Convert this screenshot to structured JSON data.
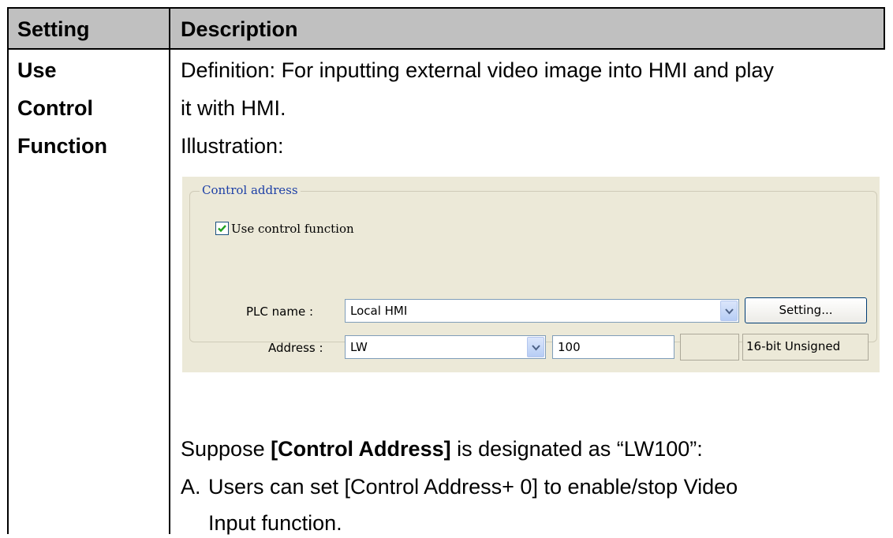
{
  "table": {
    "header": {
      "setting": "Setting",
      "description": "Description"
    },
    "row": {
      "setting_lines": [
        "Use",
        "Control",
        "Function"
      ],
      "definition_line1": "Definition: For inputting external video image into HMI and play",
      "definition_line2": "it with HMI.",
      "illustration_label": "Illustration:",
      "suppose_prefix": "Suppose ",
      "suppose_bold": "[Control Address]",
      "suppose_suffix": " is designated as “LW100”:",
      "item_a_marker": "A.",
      "item_a_line1": "Users can set [Control Address+ 0] to enable/stop Video",
      "item_a_line2": "Input function."
    }
  },
  "illustration": {
    "group_title": "Control address",
    "checkbox_label": "Use control function",
    "checkbox_checked": true,
    "plc_name_label": "PLC name :",
    "plc_name_value": "Local HMI",
    "setting_button": "Setting...",
    "address_label": "Address :",
    "address_type": "LW",
    "address_value": "100",
    "data_format": "16-bit Unsigned"
  },
  "colors": {
    "header_bg": "#c0c0c0",
    "panel_bg": "#ece9d8",
    "group_title": "#1c3fa6"
  }
}
